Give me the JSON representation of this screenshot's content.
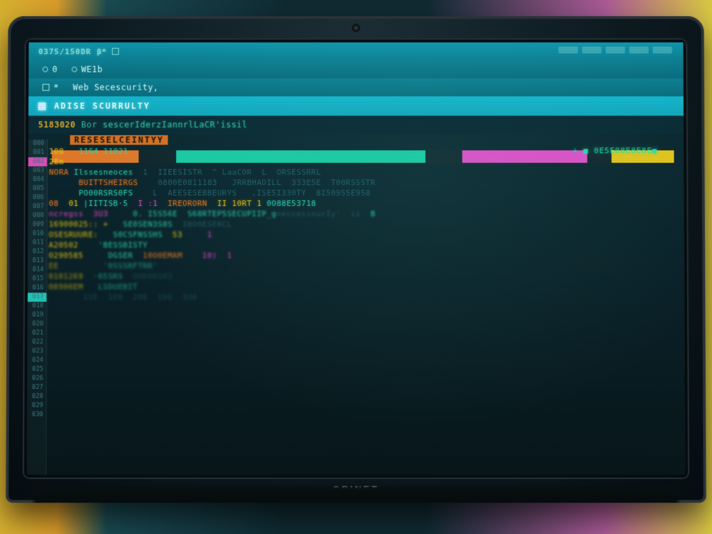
{
  "titlebar": {
    "session_id": "0375/150DR",
    "glyph": "β*"
  },
  "tabs": [
    {
      "icon": "radio",
      "label": "0"
    },
    {
      "icon": "radio",
      "label": "WE1b"
    },
    {
      "icon": "check",
      "label": "*"
    },
    {
      "icon": "none",
      "label": "Web Secescurity,"
    }
  ],
  "active_tab": {
    "label": "ADISE  SCURRULTY"
  },
  "header2": {
    "line_no": "5183020",
    "func_prefix": "Bor",
    "func_name": "sescerIderzIannrlLaCR'issil"
  },
  "warn_tag": "RESESELCEINTYY",
  "annot_right": "+ ■ 0E5E08E8E8E■",
  "progress": {
    "segments": [
      "orange",
      "gap",
      "teal",
      "gap",
      "magenta",
      "gap",
      "yellow"
    ]
  },
  "gutter_numbers": [
    "000",
    "001",
    "002",
    "003",
    "004",
    "005",
    "006",
    "007",
    "008",
    "009",
    "010",
    "011",
    "012",
    "013",
    "014",
    "015",
    "016",
    "017",
    "018",
    "019",
    "020",
    "021",
    "022",
    "023",
    "024",
    "025",
    "026",
    "027",
    "028",
    "029",
    "030"
  ],
  "code_lines": [
    {
      "cls": "blurlite",
      "tokens": [
        [
          "tok-num",
          "108 "
        ],
        [
          "tok-id",
          "  1164 11021"
        ]
      ]
    },
    {
      "cls": "blurlite",
      "tokens": [
        [
          "tok-num",
          "28m"
        ]
      ]
    },
    {
      "cls": "blurlite",
      "tokens": [
        [
          "tok-kw",
          "NORA "
        ],
        [
          "tok-id",
          "Ilssesneoces  "
        ],
        [
          "tok-com",
          "1  IIEESISTR  ^ LaaCOR  L  ORSESSRRL"
        ]
      ]
    },
    {
      "cls": "blurlite",
      "tokens": [
        [
          "tok-kw",
          "      BUITTSHEIRGS  "
        ],
        [
          "tok-com",
          "  0800E0811183   JRRBHADILL  333E5E  T00RSSSTR"
        ]
      ]
    },
    {
      "cls": "blurlite",
      "tokens": [
        [
          "tok-id",
          "      PO00RSRS0FS  "
        ],
        [
          "tok-com",
          "  L  AEESESEBBEURYS   ,ISE5I330TY  8I50955E958"
        ]
      ]
    },
    {
      "cls": "",
      "tokens": [
        [
          "",
          ""
        ]
      ]
    },
    {
      "cls": "blurlite",
      "tokens": [
        [
          "tok-kw",
          "08  "
        ],
        [
          "tok-num",
          "01"
        ],
        [
          "tok-id",
          " |IITISB·5  "
        ],
        [
          "tok-str",
          "I :1  "
        ],
        [
          "tok-kw",
          "IREORORN  "
        ],
        [
          "tok-num",
          "II 10RT 1 "
        ],
        [
          "tok-id",
          "0O88E53718"
        ]
      ]
    },
    {
      "cls": "",
      "tokens": [
        [
          "",
          ""
        ]
      ]
    },
    {
      "cls": "blurmed",
      "tokens": [
        [
          "tok-str",
          "ncregss  3U3"
        ],
        [
          "tok-id",
          "     0. I5S56E  S68RTEP5SECUPIIP_g"
        ],
        [
          "tok-com",
          "neosessnurIy'  ii"
        ],
        [
          "tok-id",
          "  B"
        ]
      ]
    },
    {
      "cls": "blurmed",
      "tokens": [
        [
          "tok-num",
          "16900025:: +   "
        ],
        [
          "tok-id",
          "SE0SEN3S8S  "
        ],
        [
          "tok-com",
          "38O0ESERCL"
        ]
      ]
    },
    {
      "cls": "blurmed",
      "tokens": [
        [
          "tok-num",
          "OSESRUURE:   "
        ],
        [
          "tok-id",
          "S0CSFNSSHS  "
        ],
        [
          "tok-num",
          "53     "
        ],
        [
          "tok-str",
          "1"
        ]
      ]
    },
    {
      "cls": "blurmed",
      "tokens": [
        [
          "tok-num",
          "A20502    "
        ],
        [
          "tok-id",
          "'BESSBISTY"
        ]
      ]
    },
    {
      "cls": "blurmed",
      "tokens": [
        [
          "tok-num",
          "O290585   "
        ],
        [
          "tok-id",
          "  DGSER  "
        ],
        [
          "tok-kw",
          "10O0EMAM  "
        ],
        [
          "tok-str",
          "  10)  1"
        ]
      ]
    },
    {
      "cls": "blurmore",
      "tokens": [
        [
          "tok-num",
          "EE         "
        ],
        [
          "tok-id",
          "'0SSSRFTRR'"
        ]
      ]
    },
    {
      "cls": "blurmore",
      "tokens": [
        [
          "tok-num",
          "0101269  "
        ],
        [
          "tok-id",
          "·65SRS  "
        ],
        [
          "tok-com",
          "OOD00103"
        ]
      ]
    },
    {
      "cls": "blurmore",
      "tokens": [
        [
          "tok-num",
          "08906EM   "
        ],
        [
          "tok-id",
          "LSDUEBIT"
        ]
      ]
    },
    {
      "cls": "blurmore",
      "tokens": [
        [
          "tok-com",
          "       15E  108  206  106  330"
        ]
      ]
    }
  ],
  "brand": "CRINET"
}
